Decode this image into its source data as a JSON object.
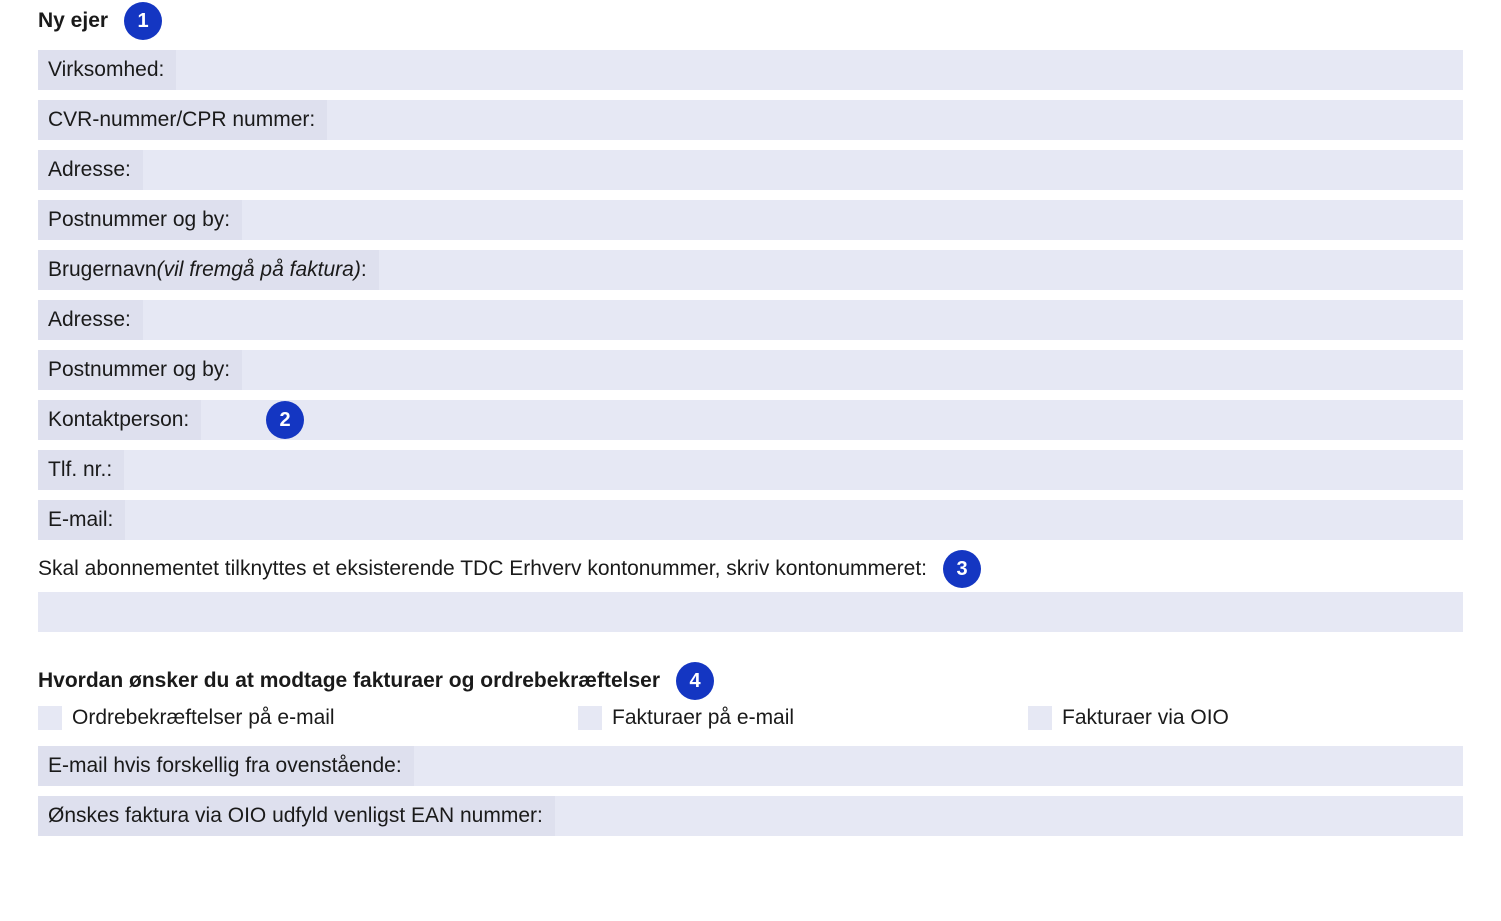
{
  "section1": {
    "title": "Ny ejer",
    "badge": "1",
    "fields": {
      "virksomhed": "Virksomhed:",
      "cvr": "CVR-nummer/CPR nummer:",
      "adresse1": "Adresse:",
      "postby1": "Postnummer og by:",
      "brugernavn_prefix": "Brugernavn ",
      "brugernavn_italic": "(vil fremgå på faktura)",
      "brugernavn_suffix": ":",
      "adresse2": "Adresse:",
      "postby2": "Postnummer og by:",
      "kontaktperson": "Kontaktperson:",
      "kontakt_badge": "2",
      "tlf": "Tlf. nr.:",
      "email": "E-mail:"
    },
    "konto_text": "Skal abonnementet tilknyttes et eksisterende TDC Erhverv kontonummer, skriv kontonummeret:",
    "konto_badge": "3"
  },
  "section2": {
    "title": "Hvordan ønsker du at modtage fakturaer og ordrebekræftelser",
    "badge": "4",
    "options": {
      "opt1": "Ordrebekræftelser på e-mail",
      "opt2": "Fakturaer på e-mail",
      "opt3": "Fakturaer via OIO"
    },
    "fields": {
      "email_diff": "E-mail hvis forskellig fra ovenstående:",
      "ean": "Ønskes faktura via OIO udfyld venligst EAN nummer:"
    }
  }
}
